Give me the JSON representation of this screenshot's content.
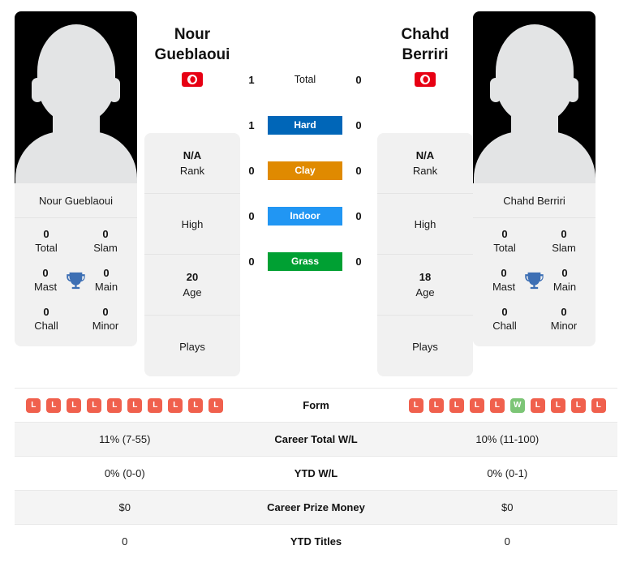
{
  "players": {
    "left": {
      "name_display": "Nour\nGueblaoui",
      "name_line1": "Nour",
      "name_line2": "Gueblaoui",
      "name_full": "Nour Gueblaoui",
      "country_flag": "tunisia-flag",
      "avatar": "player-silhouette-placeholder",
      "info": [
        {
          "value": "N/A",
          "label": "Rank"
        },
        {
          "value": "",
          "label": "High"
        },
        {
          "value": "20",
          "label": "Age"
        },
        {
          "value": "",
          "label": "Plays"
        }
      ],
      "titles": [
        {
          "value": "0",
          "label": "Total"
        },
        {
          "value": "0",
          "label": "Slam"
        },
        {
          "value": "0",
          "label": "Mast"
        },
        {
          "value": "0",
          "label": "Main"
        },
        {
          "value": "0",
          "label": "Chall"
        },
        {
          "value": "0",
          "label": "Minor"
        }
      ],
      "form": [
        "L",
        "L",
        "L",
        "L",
        "L",
        "L",
        "L",
        "L",
        "L",
        "L"
      ],
      "career_total_wl": "11% (7-55)",
      "ytd_wl": "0% (0-0)",
      "career_prize_money": "$0",
      "ytd_titles": "0"
    },
    "right": {
      "name_display": "Chahd Berriri",
      "name_line1": "Chahd Berriri",
      "name_line2": "",
      "name_full": "Chahd Berriri",
      "country_flag": "tunisia-flag",
      "avatar": "player-silhouette-placeholder",
      "info": [
        {
          "value": "N/A",
          "label": "Rank"
        },
        {
          "value": "",
          "label": "High"
        },
        {
          "value": "18",
          "label": "Age"
        },
        {
          "value": "",
          "label": "Plays"
        }
      ],
      "titles": [
        {
          "value": "0",
          "label": "Total"
        },
        {
          "value": "0",
          "label": "Slam"
        },
        {
          "value": "0",
          "label": "Mast"
        },
        {
          "value": "0",
          "label": "Main"
        },
        {
          "value": "0",
          "label": "Chall"
        },
        {
          "value": "0",
          "label": "Minor"
        }
      ],
      "form": [
        "L",
        "L",
        "L",
        "L",
        "L",
        "W",
        "L",
        "L",
        "L",
        "L"
      ],
      "career_total_wl": "10% (11-100)",
      "ytd_wl": "0% (0-1)",
      "career_prize_money": "$0",
      "ytd_titles": "0"
    }
  },
  "head_to_head": [
    {
      "label": "Total",
      "left": "1",
      "right": "0",
      "color": ""
    },
    {
      "label": "Hard",
      "left": "1",
      "right": "0",
      "color": "#0066b8"
    },
    {
      "label": "Clay",
      "left": "0",
      "right": "0",
      "color": "#e08a00"
    },
    {
      "label": "Indoor",
      "left": "0",
      "right": "0",
      "color": "#2196f3"
    },
    {
      "label": "Grass",
      "left": "0",
      "right": "0",
      "color": "#00a033"
    }
  ],
  "stats_rows": [
    {
      "label": "Form",
      "left": "",
      "right": ""
    },
    {
      "label": "Career Total W/L",
      "left": "11% (7-55)",
      "right": "10% (11-100)"
    },
    {
      "label": "YTD W/L",
      "left": "0% (0-0)",
      "right": "0% (0-1)"
    },
    {
      "label": "Career Prize Money",
      "left": "$0",
      "right": "$0"
    },
    {
      "label": "YTD Titles",
      "left": "0",
      "right": "0"
    }
  ],
  "colors": {
    "hard": "#0066b8",
    "clay": "#e08a00",
    "indoor": "#2196f3",
    "grass": "#00a033",
    "loss_badge": "#f0604d",
    "win_badge": "#7cc576",
    "flag_red": "#e70013",
    "trophy": "#3d6fb4",
    "card_bg": "#f1f1f1"
  }
}
